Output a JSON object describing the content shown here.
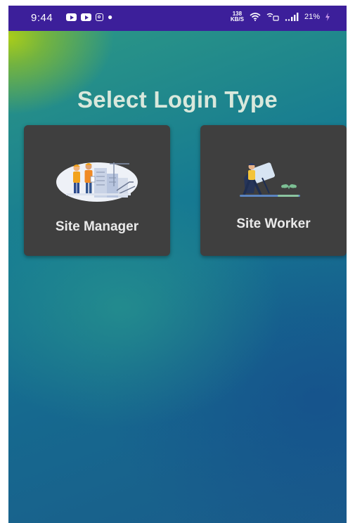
{
  "status_bar": {
    "time": "9:44",
    "left_icons": [
      "youtube-icon",
      "youtube-icon",
      "instagram-icon",
      "notification-icon"
    ],
    "net_speed_value": "138",
    "net_speed_unit": "KB/S",
    "battery": "21%",
    "icons": [
      "wifi-icon",
      "volte-icon",
      "signal-icon",
      "charging-icon"
    ]
  },
  "page": {
    "title": "Select Login Type"
  },
  "cards": [
    {
      "label": "Site Manager",
      "illustration": "site-manager-illustration"
    },
    {
      "label": "Site Worker",
      "illustration": "site-worker-illustration"
    }
  ],
  "colors": {
    "status_bar": "#3c1f9a",
    "card_background": "#3f3f3f",
    "title_text": "#d9e8dc",
    "card_text": "#eaeaea"
  }
}
